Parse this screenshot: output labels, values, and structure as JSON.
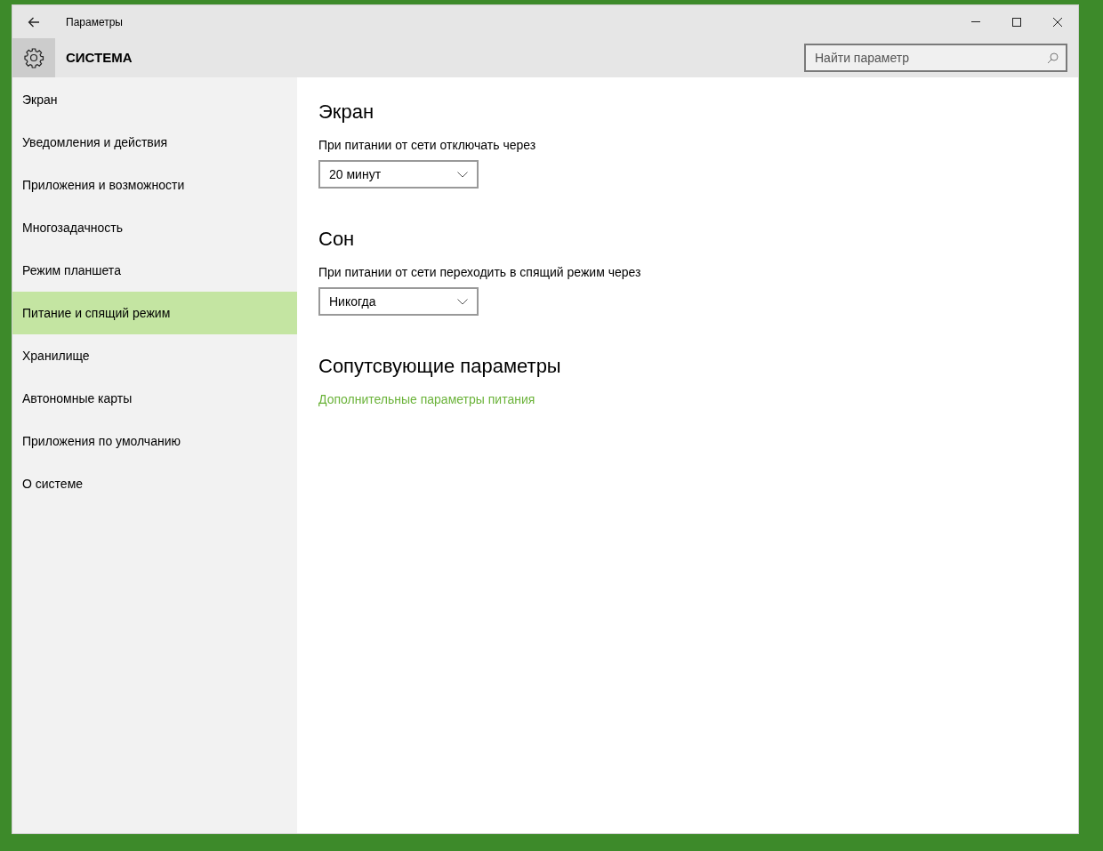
{
  "window": {
    "title": "Параметры"
  },
  "header": {
    "title": "СИСТЕМА",
    "search": {
      "placeholder": "Найти параметр"
    }
  },
  "sidebar": {
    "items": [
      {
        "label": "Экран",
        "selected": false
      },
      {
        "label": "Уведомления и действия",
        "selected": false
      },
      {
        "label": "Приложения и возможности",
        "selected": false
      },
      {
        "label": "Многозадачность",
        "selected": false
      },
      {
        "label": "Режим планшета",
        "selected": false
      },
      {
        "label": "Питание и спящий режим",
        "selected": true
      },
      {
        "label": "Хранилище",
        "selected": false
      },
      {
        "label": "Автономные карты",
        "selected": false
      },
      {
        "label": "Приложения по умолчанию",
        "selected": false
      },
      {
        "label": "О системе",
        "selected": false
      }
    ]
  },
  "sections": [
    {
      "heading": "Экран",
      "kind": "dropdown",
      "label": "При питании от сети отключать через",
      "value": "20 минут"
    },
    {
      "heading": "Сон",
      "kind": "dropdown",
      "label": "При питании от сети переходить в спящий режим через",
      "value": "Никогда"
    },
    {
      "heading": "Сопутсвующие параметры",
      "kind": "link",
      "link": "Дополнительные параметры питания"
    }
  ]
}
